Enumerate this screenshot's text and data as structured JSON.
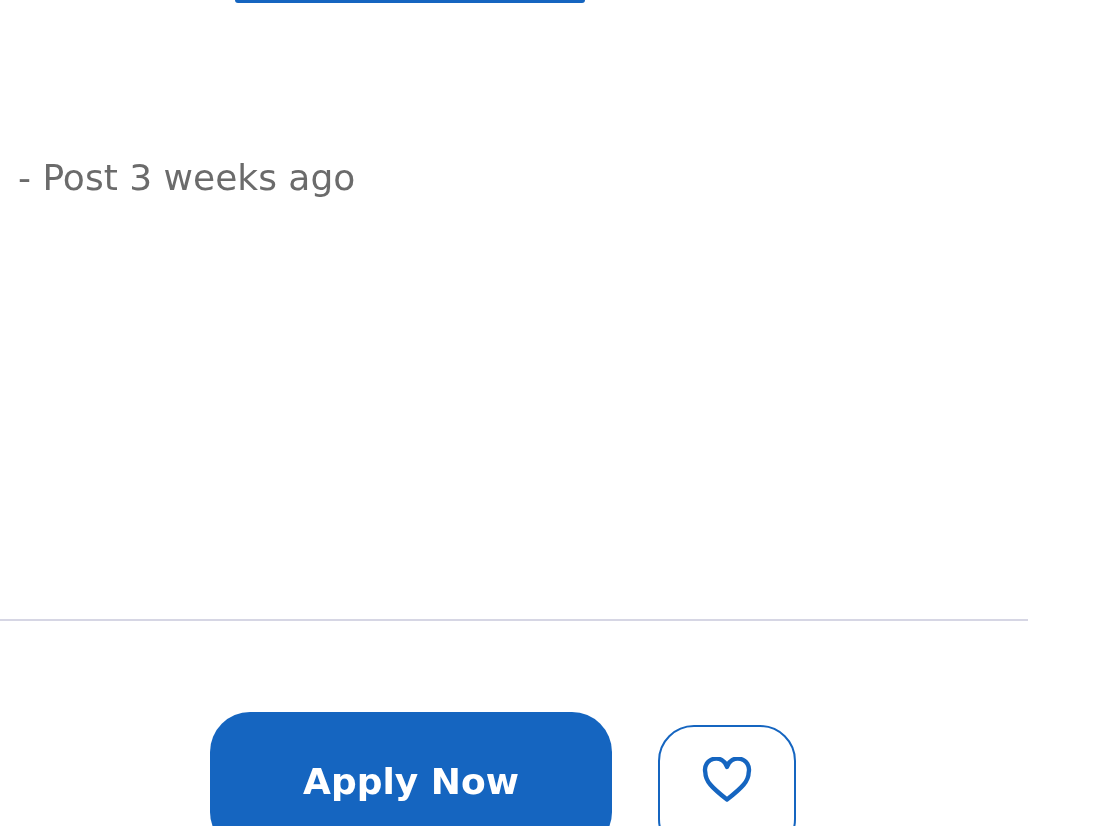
{
  "job_meta": {
    "posted": "- Post 3 weeks ago"
  },
  "actions": {
    "apply_label": "Apply Now",
    "saved": false
  }
}
